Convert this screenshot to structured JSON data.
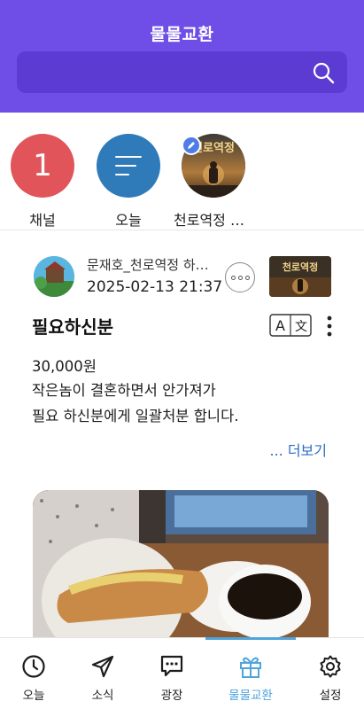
{
  "header": {
    "title": "물물교환"
  },
  "search": {
    "icon": "search-icon"
  },
  "channels": [
    {
      "label": "채널",
      "count": "1",
      "color": "#e0545a"
    },
    {
      "label": "오늘",
      "icon": "list-icon",
      "color": "#2f7ab9"
    },
    {
      "label": "천로역정 하이라이트",
      "thumb_text": "천로역정",
      "icon": "pencil-badge-icon"
    }
  ],
  "post": {
    "author": "문재호_천로역정 하이라이트",
    "date": "2025-02-13 21:37",
    "thumb_text": "천로역정",
    "title": "필요하신분",
    "translate_icon": {
      "left": "A",
      "right": "文"
    },
    "lines": [
      "30,000원",
      "작은놈이 결혼하면서 안가져가",
      "필요 하신분에게 일괄처분 합니다."
    ],
    "see_more": "... 더보기"
  },
  "tabs": [
    {
      "label": "오늘",
      "icon": "clock-icon"
    },
    {
      "label": "소식",
      "icon": "paper-plane-icon"
    },
    {
      "label": "광장",
      "icon": "chat-bubble-icon"
    },
    {
      "label": "물물교환",
      "icon": "gift-icon",
      "active": true
    },
    {
      "label": "설정",
      "icon": "gear-icon"
    }
  ],
  "colors": {
    "header": "#6e4ee6",
    "search": "#5c3bd2",
    "accent": "#4fa4dc",
    "link": "#2b6cc4"
  }
}
